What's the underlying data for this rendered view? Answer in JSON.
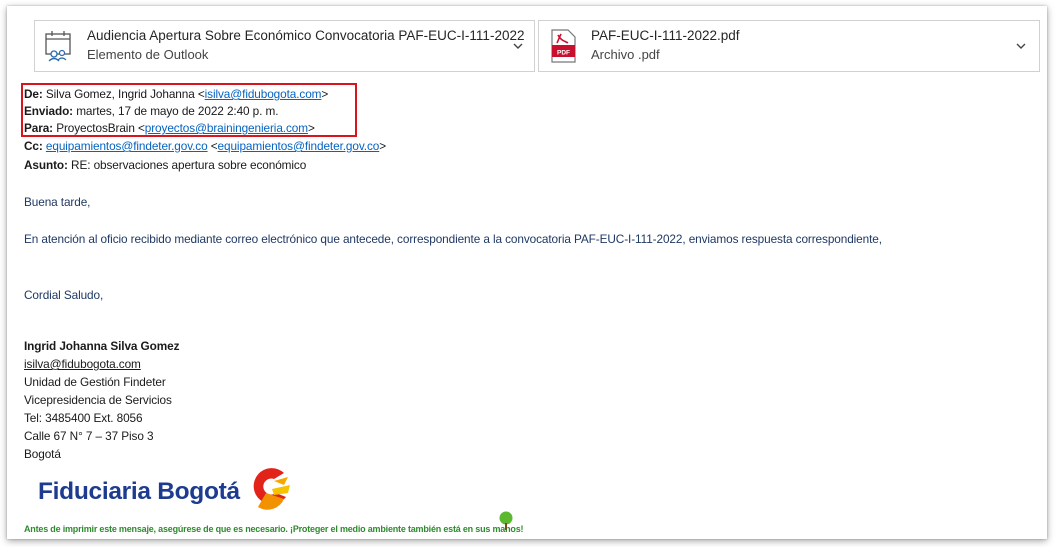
{
  "attachments": [
    {
      "title": "Audiencia Apertura Sobre Económico Convocatoria PAF-EUC-I-111-2022",
      "subtitle": "Elemento de Outlook",
      "icon": "outlook-calendar-icon"
    },
    {
      "title": "PAF-EUC-I-111-2022.pdf",
      "subtitle": "Archivo .pdf",
      "icon": "pdf-icon",
      "pdf_label": "PDF"
    }
  ],
  "header": {
    "from_label": "De:",
    "from_name": " Silva Gomez, Ingrid Johanna <",
    "from_email": "isilva@fidubogota.com",
    "from_close": ">",
    "sent_label": "Enviado:",
    "sent_value": " martes, 17 de mayo de 2022 2:40 p. m.",
    "to_label": "Para:",
    "to_name": " ProyectosBrain <",
    "to_email": "proyectos@brainingenieria.com",
    "to_close": ">",
    "cc_label": "Cc:",
    "cc_email1": "equipamientos@findeter.gov.co",
    "cc_mid": " <",
    "cc_email2": "equipamientos@findeter.gov.co",
    "cc_close": ">",
    "subject_label": "Asunto:",
    "subject_value": " RE: observaciones apertura sobre económico"
  },
  "body": {
    "greeting": "Buena tarde,",
    "paragraph": "En atención al oficio recibido mediante correo electrónico que antecede, correspondiente a la convocatoria PAF-EUC-I-111-2022, enviamos respuesta correspondiente,",
    "closing": "Cordial Saludo,"
  },
  "signature": {
    "name": "Ingrid Johanna Silva Gomez",
    "email": "isilva@fidubogota.com",
    "unit": "Unidad de Gestión Findeter",
    "vp": "Vicepresidencia de Servicios",
    "tel": "Tel: 3485400 Ext. 8056",
    "address": "Calle 67 N° 7 – 37 Piso 3",
    "city": "Bogotá",
    "logo_text": "Fiduciaria Bogotá",
    "eco_note": "Antes de imprimir este mensaje, asegúrese de que es necesario. ¡Proteger el medio ambiente también está en sus manos!"
  },
  "colors": {
    "highlight_box": "#d9141c",
    "link": "#0563c1",
    "logo_blue": "#1d3c8f",
    "eco_green": "#2e8b2e"
  }
}
